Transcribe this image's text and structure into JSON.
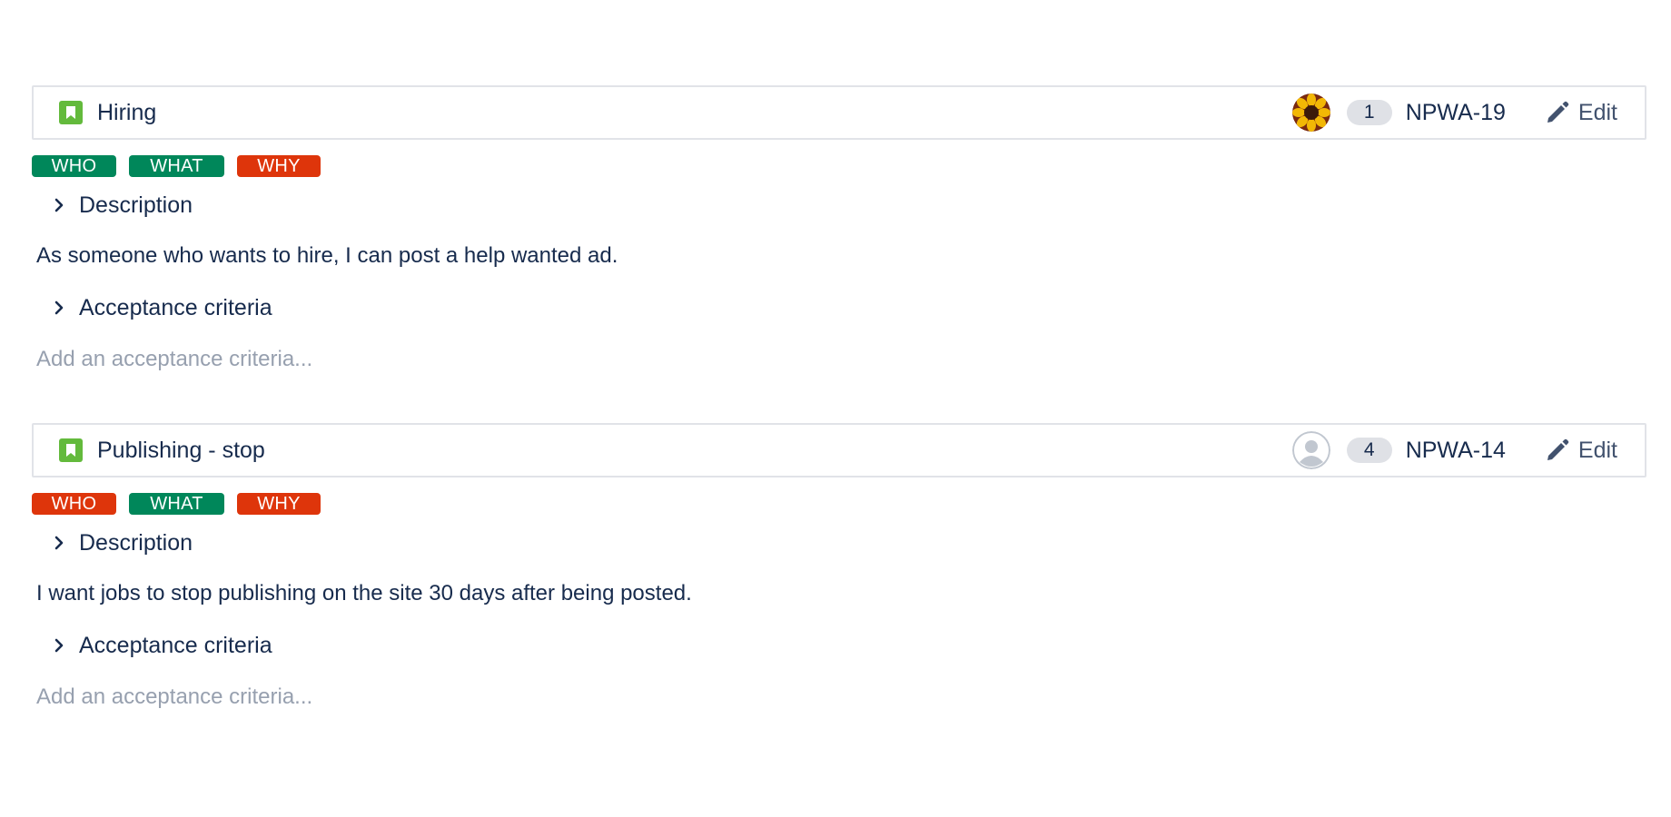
{
  "colors": {
    "green": "#00875a",
    "red": "#de350b",
    "story_icon": "#63ba3c",
    "badge_bg": "#dfe1e6"
  },
  "stories": [
    {
      "title": "Hiring",
      "comment_count": "1",
      "key": "NPWA-19",
      "edit_label": "Edit",
      "avatar": "sunflower-avatar",
      "lozenges": [
        {
          "label": "WHO",
          "color": "#00875a"
        },
        {
          "label": "WHAT",
          "color": "#00875a"
        },
        {
          "label": "WHY",
          "color": "#de350b"
        }
      ],
      "description_label": "Description",
      "description": "As someone who wants to hire, I can post a help wanted ad.",
      "acceptance_label": "Acceptance criteria",
      "acceptance_placeholder": "Add an acceptance criteria..."
    },
    {
      "title": "Publishing - stop",
      "comment_count": "4",
      "key": "NPWA-14",
      "edit_label": "Edit",
      "avatar": "default-user-avatar",
      "lozenges": [
        {
          "label": "WHO",
          "color": "#de350b"
        },
        {
          "label": "WHAT",
          "color": "#00875a"
        },
        {
          "label": "WHY",
          "color": "#de350b"
        }
      ],
      "description_label": "Description",
      "description": "I want jobs to stop publishing on the site 30 days after being posted.",
      "acceptance_label": "Acceptance criteria",
      "acceptance_placeholder": "Add an acceptance criteria..."
    }
  ]
}
